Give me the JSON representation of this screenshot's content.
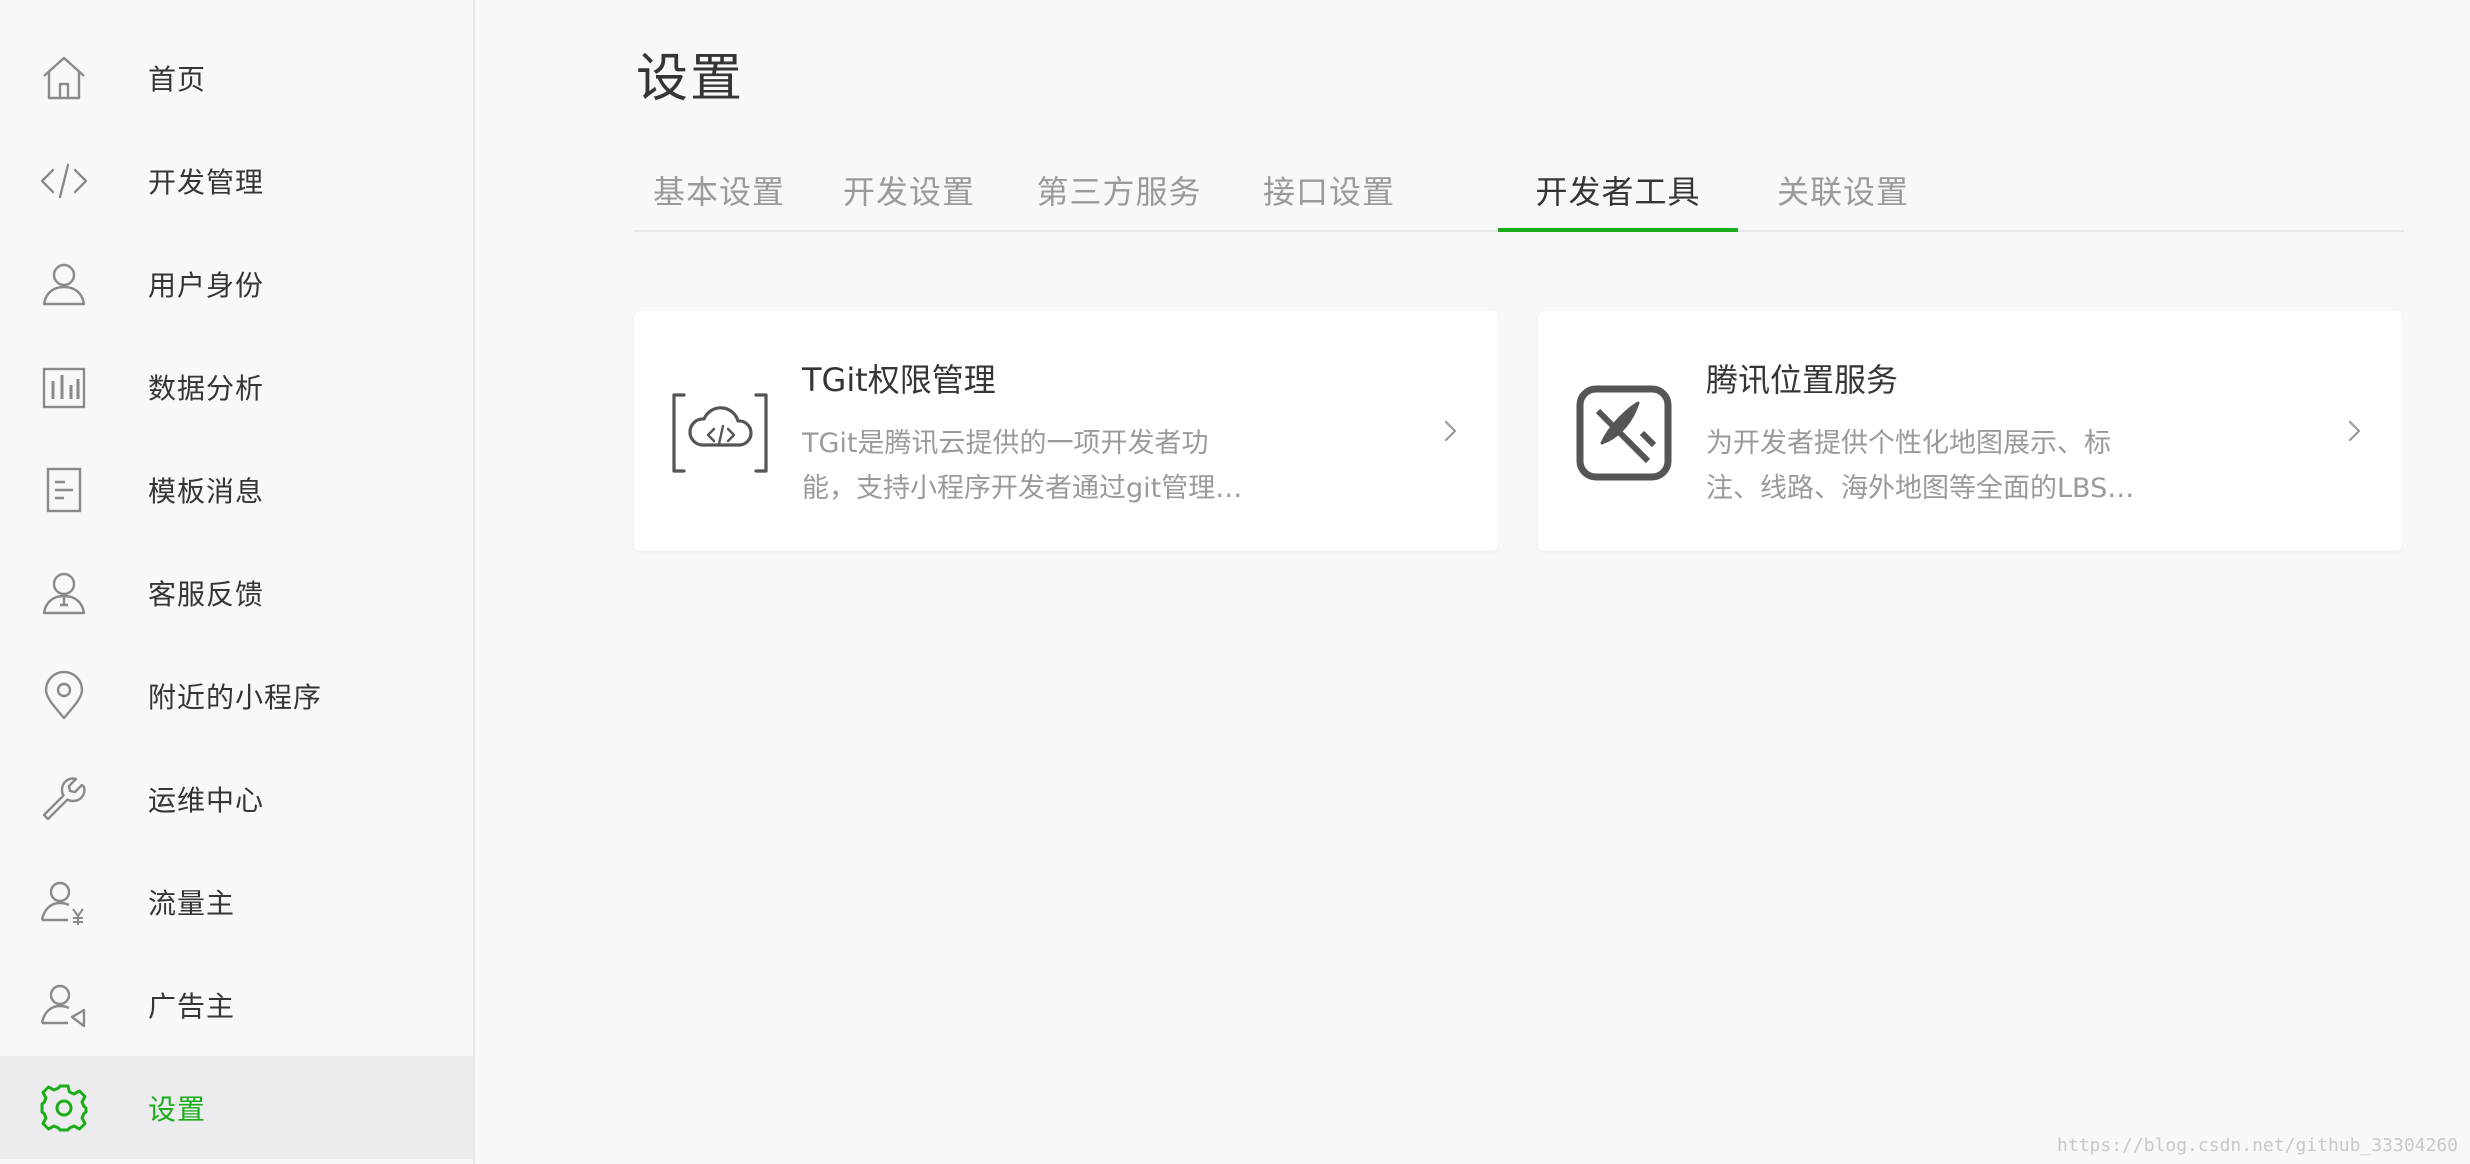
{
  "colors": {
    "accent": "#1aad19",
    "text": "#353535",
    "muted": "#9a9a9a",
    "background": "#f7f8fa"
  },
  "sidebar": {
    "items": [
      {
        "label": "首页",
        "icon": "home-icon"
      },
      {
        "label": "开发管理",
        "icon": "code-icon"
      },
      {
        "label": "用户身份",
        "icon": "user-icon"
      },
      {
        "label": "数据分析",
        "icon": "bar-chart-icon"
      },
      {
        "label": "模板消息",
        "icon": "document-icon"
      },
      {
        "label": "客服反馈",
        "icon": "customer-service-icon"
      },
      {
        "label": "附近的小程序",
        "icon": "location-pin-icon"
      },
      {
        "label": "运维中心",
        "icon": "wrench-icon"
      },
      {
        "label": "流量主",
        "icon": "user-yen-icon"
      },
      {
        "label": "广告主",
        "icon": "user-megaphone-icon"
      },
      {
        "label": "设置",
        "icon": "gear-icon",
        "active": true
      }
    ]
  },
  "main": {
    "title": "设置",
    "tabs": [
      {
        "label": "基本设置"
      },
      {
        "label": "开发设置"
      },
      {
        "label": "第三方服务"
      },
      {
        "label": "接口设置"
      },
      {
        "label": "开发者工具",
        "active": true
      },
      {
        "label": "关联设置"
      }
    ],
    "cards": [
      {
        "icon": "cloud-code-icon",
        "title": "TGit权限管理",
        "desc_line1": "TGit是腾讯云提供的一项开发者功",
        "desc_line2": "能，支持小程序开发者通过git管理…"
      },
      {
        "icon": "map-compass-icon",
        "title": "腾讯位置服务",
        "desc_line1": "为开发者提供个性化地图展示、标",
        "desc_line2": "注、线路、海外地图等全面的LBS…"
      }
    ]
  },
  "watermark": "https://blog.csdn.net/github_33304260"
}
